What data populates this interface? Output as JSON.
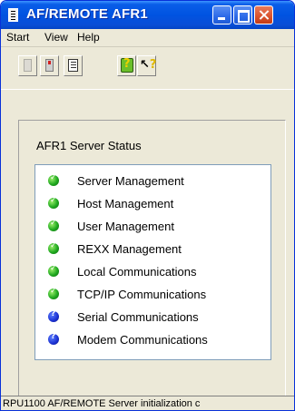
{
  "window": {
    "title": "AF/REMOTE AFR1",
    "icon": "app-document-icon"
  },
  "menu": [
    "Start",
    "View",
    "Help"
  ],
  "toolbar": {
    "buttons": [
      {
        "name": "start-server-button",
        "icon": "document-icon-disabled"
      },
      {
        "name": "stop-server-button",
        "icon": "document-red-icon"
      },
      {
        "name": "log-button",
        "icon": "list-icon"
      },
      {
        "name": "help-button",
        "icon": "help-book-icon"
      },
      {
        "name": "context-help-button",
        "icon": "arrow-question-icon"
      }
    ]
  },
  "server_status": {
    "title": "AFR1 Server Status",
    "items": [
      {
        "label": "Server Management",
        "status": "ok",
        "color": "#1fa81f"
      },
      {
        "label": "Host Management",
        "status": "ok",
        "color": "#1fa81f"
      },
      {
        "label": "User Management",
        "status": "ok",
        "color": "#1fa81f"
      },
      {
        "label": "REXX Management",
        "status": "ok",
        "color": "#1fa81f"
      },
      {
        "label": "Local Communications",
        "status": "ok",
        "color": "#1fa81f"
      },
      {
        "label": "TCP/IP Communications",
        "status": "ok",
        "color": "#1fa81f"
      },
      {
        "label": "Serial Communications",
        "status": "unknown",
        "color": "#1a2fd0"
      },
      {
        "label": "Modem Communications",
        "status": "unknown",
        "color": "#1a2fd0"
      }
    ]
  },
  "statusbar": {
    "text": "RPU1100 AF/REMOTE Server initialization c"
  }
}
